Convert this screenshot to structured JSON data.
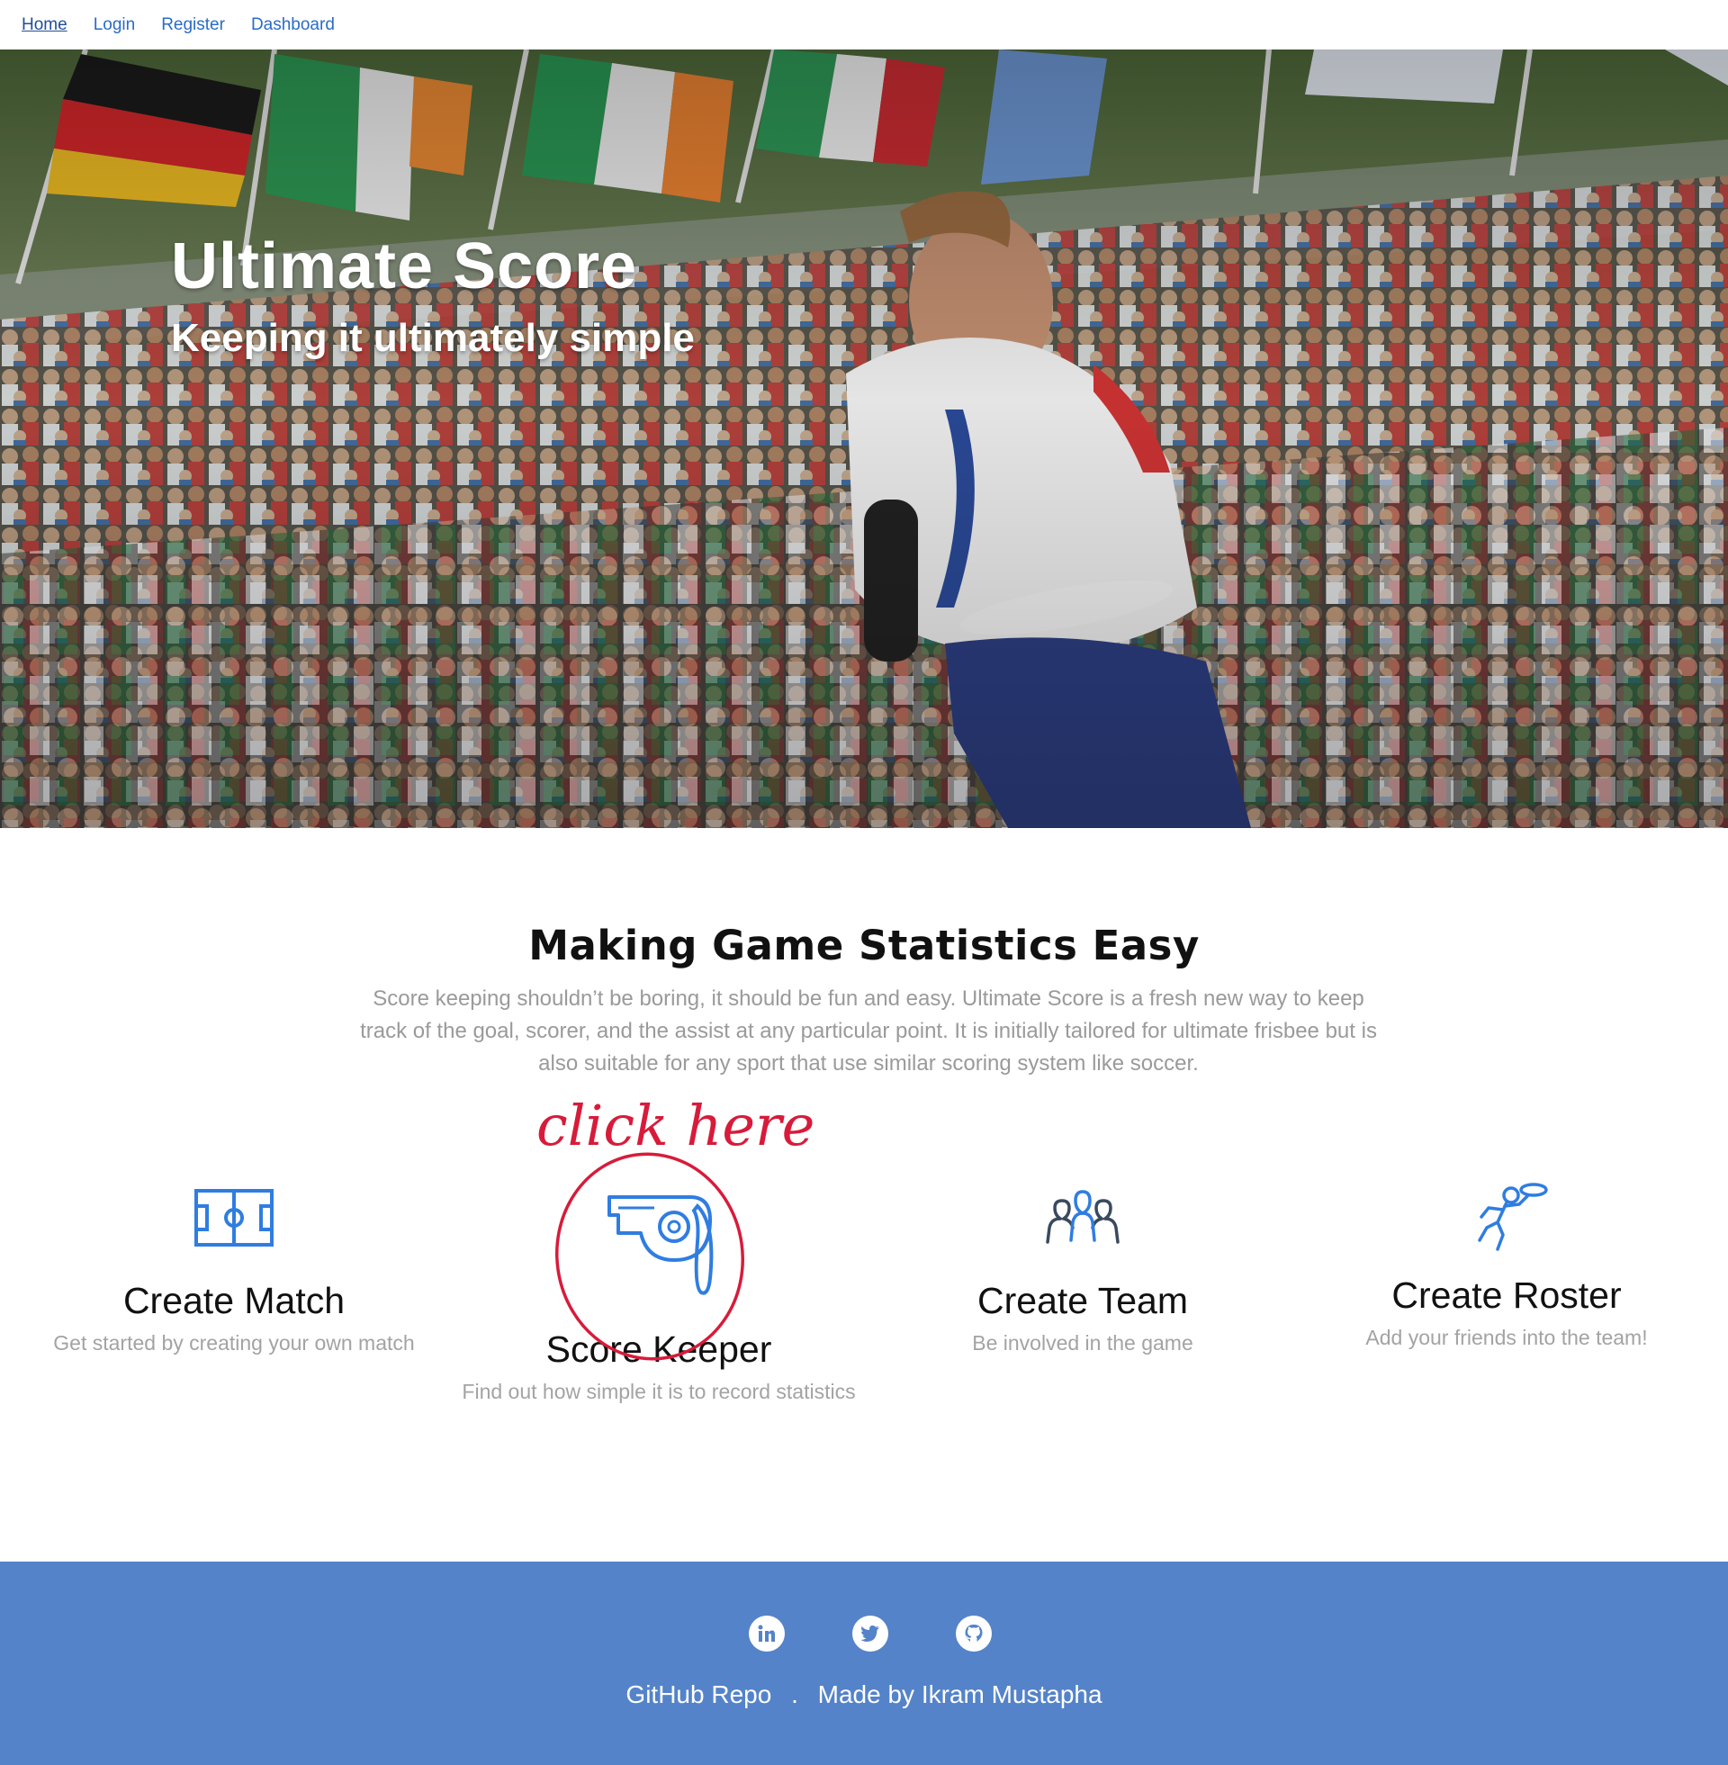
{
  "nav": {
    "home": "Home",
    "login": "Login",
    "register": "Register",
    "dashboard": "Dashboard"
  },
  "hero": {
    "title": "Ultimate Score",
    "subtitle": "Keeping it ultimately simple"
  },
  "intro": {
    "title": "Making Game Statistics Easy",
    "text": "Score keeping shouldn’t be boring, it should be fun and easy. Ultimate Score is a fresh new way to keep track of the goal, scorer, and the assist at any particular point. It is initially tailored for ultimate frisbee but is also suitable for any sport that use similar scoring system like soccer."
  },
  "features": [
    {
      "icon": "soccer-field-icon",
      "title": "Create Match",
      "desc": "Get started by creating your own match"
    },
    {
      "icon": "whistle-icon",
      "title": "Score Keeper",
      "desc": "Find out how simple it is to record statistics"
    },
    {
      "icon": "team-people-icon",
      "title": "Create Team",
      "desc": "Be involved in the game"
    },
    {
      "icon": "frisbee-player-icon",
      "title": "Create Roster",
      "desc": "Add your friends into the team!"
    }
  ],
  "annotation": {
    "text": "click here",
    "color": "#d81b3a"
  },
  "footer": {
    "social": [
      "linkedin-icon",
      "twitter-icon",
      "github-icon"
    ],
    "repo_label": "GitHub Repo",
    "separator": ".",
    "made_by": "Made by Ikram Mustapha",
    "bg_color": "#5483c9"
  },
  "colors": {
    "icon_blue": "#2f7de1",
    "link_blue": "#2a6cc7"
  }
}
